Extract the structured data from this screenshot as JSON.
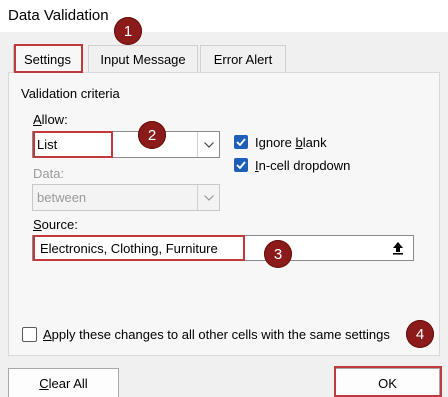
{
  "window": {
    "title": "Data Validation"
  },
  "tabs": [
    {
      "label": "Settings",
      "active": true
    },
    {
      "label": "Input Message",
      "active": false
    },
    {
      "label": "Error Alert",
      "active": false
    }
  ],
  "group": {
    "label": "Validation criteria"
  },
  "allow": {
    "label_first": "A",
    "label_rest": "llow:",
    "value": "List"
  },
  "options": {
    "ignore_blank": {
      "label_prefix": "Ignore ",
      "label_underlined": "b",
      "label_rest": "lank",
      "checked": true
    },
    "in_cell_dropdown": {
      "label_underlined": "I",
      "label_rest": "n-cell dropdown",
      "checked": true
    }
  },
  "data": {
    "label": "Data:",
    "value": "between"
  },
  "source": {
    "label_first": "S",
    "label_rest": "ource:",
    "value": "Electronics, Clothing, Furniture"
  },
  "apply_all": {
    "label_first": "A",
    "label_second": "p",
    "label_rest": "ply these changes to all other cells with the same settings",
    "checked": false
  },
  "buttons": {
    "clear_all_first": "C",
    "clear_all_rest": "lear All",
    "ok": "OK"
  },
  "annotations": [
    "1",
    "2",
    "3",
    "4"
  ],
  "colors": {
    "badge": "#8b1a1a",
    "highlight": "#c0393b",
    "checkbox": "#1f5fb8"
  }
}
